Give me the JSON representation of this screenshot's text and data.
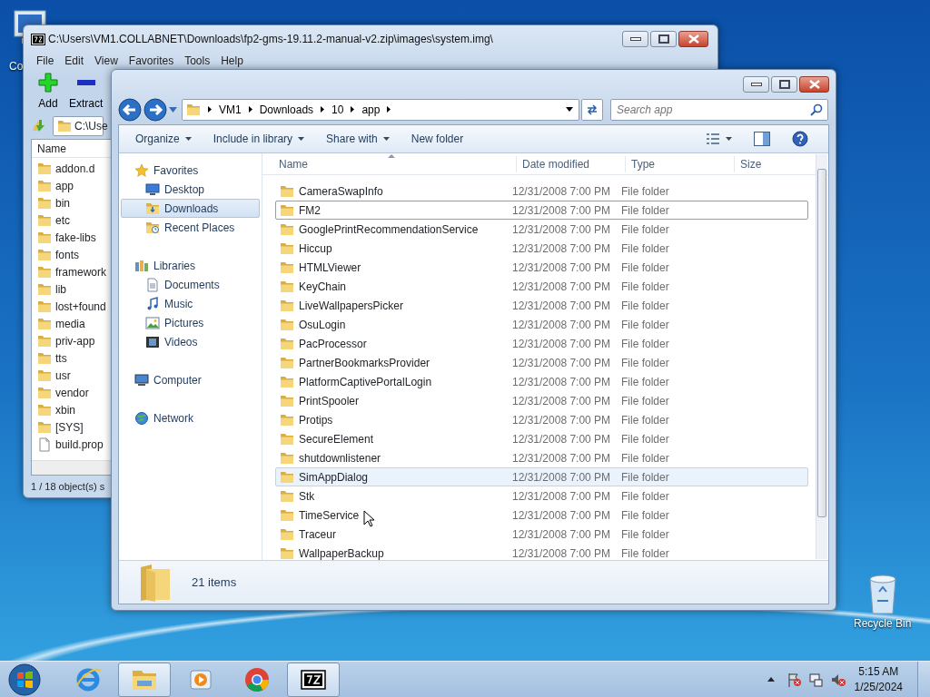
{
  "desktop_icons": [
    {
      "label": "Co",
      "kind": "computer"
    },
    {
      "label": "Recycle Bin",
      "kind": "recycle"
    }
  ],
  "archive_window": {
    "title": "C:\\Users\\VM1.COLLABNET\\Downloads\\fp2-gms-19.11.2-manual-v2.zip\\images\\system.img\\",
    "menu": [
      "File",
      "Edit",
      "View",
      "Favorites",
      "Tools",
      "Help"
    ],
    "toolbar": [
      {
        "label": "Add",
        "kind": "add"
      },
      {
        "label": "Extract",
        "kind": "extract"
      }
    ],
    "address": "C:\\Use",
    "column": "Name",
    "items": [
      {
        "name": "addon.d",
        "kind": "folder"
      },
      {
        "name": "app",
        "kind": "folder"
      },
      {
        "name": "bin",
        "kind": "folder"
      },
      {
        "name": "etc",
        "kind": "folder"
      },
      {
        "name": "fake-libs",
        "kind": "folder"
      },
      {
        "name": "fonts",
        "kind": "folder"
      },
      {
        "name": "framework",
        "kind": "folder"
      },
      {
        "name": "lib",
        "kind": "folder"
      },
      {
        "name": "lost+found",
        "kind": "folder"
      },
      {
        "name": "media",
        "kind": "folder"
      },
      {
        "name": "priv-app",
        "kind": "folder"
      },
      {
        "name": "tts",
        "kind": "folder"
      },
      {
        "name": "usr",
        "kind": "folder"
      },
      {
        "name": "vendor",
        "kind": "folder"
      },
      {
        "name": "xbin",
        "kind": "folder"
      },
      {
        "name": "[SYS]",
        "kind": "folder"
      },
      {
        "name": "build.prop",
        "kind": "file"
      }
    ],
    "status": "1 / 18 object(s) s"
  },
  "explorer": {
    "breadcrumb": [
      "VM1",
      "Downloads",
      "10",
      "app"
    ],
    "search": {
      "placeholder": "Search app"
    },
    "commands": [
      {
        "label": "Organize",
        "dropdown": true
      },
      {
        "label": "Include in library",
        "dropdown": true
      },
      {
        "label": "Share with",
        "dropdown": true
      },
      {
        "label": "New folder",
        "dropdown": false
      }
    ],
    "nav": [
      {
        "label": "Favorites",
        "kind": "favorites",
        "selected": false,
        "children": [
          {
            "label": "Desktop",
            "kind": "desktop",
            "selected": false
          },
          {
            "label": "Downloads",
            "kind": "downloads",
            "selected": true
          },
          {
            "label": "Recent Places",
            "kind": "recent",
            "selected": false
          }
        ]
      },
      {
        "label": "Libraries",
        "kind": "libraries",
        "selected": false,
        "children": [
          {
            "label": "Documents",
            "kind": "documents",
            "selected": false
          },
          {
            "label": "Music",
            "kind": "music",
            "selected": false
          },
          {
            "label": "Pictures",
            "kind": "pictures",
            "selected": false
          },
          {
            "label": "Videos",
            "kind": "videos",
            "selected": false
          }
        ]
      },
      {
        "label": "Computer",
        "kind": "computer",
        "selected": false
      },
      {
        "label": "Network",
        "kind": "network",
        "selected": false
      }
    ],
    "columns": [
      "Name",
      "Date modified",
      "Type",
      "Size"
    ],
    "rows": [
      {
        "name": "CameraSwapInfo",
        "date": "12/31/2008 7:00 PM",
        "type": "File folder",
        "focused": false,
        "hovered": false
      },
      {
        "name": "FM2",
        "date": "12/31/2008 7:00 PM",
        "type": "File folder",
        "focused": true,
        "hovered": false
      },
      {
        "name": "GooglePrintRecommendationService",
        "date": "12/31/2008 7:00 PM",
        "type": "File folder",
        "focused": false,
        "hovered": false
      },
      {
        "name": "Hiccup",
        "date": "12/31/2008 7:00 PM",
        "type": "File folder",
        "focused": false,
        "hovered": false
      },
      {
        "name": "HTMLViewer",
        "date": "12/31/2008 7:00 PM",
        "type": "File folder",
        "focused": false,
        "hovered": false
      },
      {
        "name": "KeyChain",
        "date": "12/31/2008 7:00 PM",
        "type": "File folder",
        "focused": false,
        "hovered": false
      },
      {
        "name": "LiveWallpapersPicker",
        "date": "12/31/2008 7:00 PM",
        "type": "File folder",
        "focused": false,
        "hovered": false
      },
      {
        "name": "OsuLogin",
        "date": "12/31/2008 7:00 PM",
        "type": "File folder",
        "focused": false,
        "hovered": false
      },
      {
        "name": "PacProcessor",
        "date": "12/31/2008 7:00 PM",
        "type": "File folder",
        "focused": false,
        "hovered": false
      },
      {
        "name": "PartnerBookmarksProvider",
        "date": "12/31/2008 7:00 PM",
        "type": "File folder",
        "focused": false,
        "hovered": false
      },
      {
        "name": "PlatformCaptivePortalLogin",
        "date": "12/31/2008 7:00 PM",
        "type": "File folder",
        "focused": false,
        "hovered": false
      },
      {
        "name": "PrintSpooler",
        "date": "12/31/2008 7:00 PM",
        "type": "File folder",
        "focused": false,
        "hovered": false
      },
      {
        "name": "Protips",
        "date": "12/31/2008 7:00 PM",
        "type": "File folder",
        "focused": false,
        "hovered": false
      },
      {
        "name": "SecureElement",
        "date": "12/31/2008 7:00 PM",
        "type": "File folder",
        "focused": false,
        "hovered": false
      },
      {
        "name": "shutdownlistener",
        "date": "12/31/2008 7:00 PM",
        "type": "File folder",
        "focused": false,
        "hovered": false
      },
      {
        "name": "SimAppDialog",
        "date": "12/31/2008 7:00 PM",
        "type": "File folder",
        "focused": false,
        "hovered": true
      },
      {
        "name": "Stk",
        "date": "12/31/2008 7:00 PM",
        "type": "File folder",
        "focused": false,
        "hovered": false
      },
      {
        "name": "TimeService",
        "date": "12/31/2008 7:00 PM",
        "type": "File folder",
        "focused": false,
        "hovered": false
      },
      {
        "name": "Traceur",
        "date": "12/31/2008 7:00 PM",
        "type": "File folder",
        "focused": false,
        "hovered": false
      },
      {
        "name": "WallpaperBackup",
        "date": "12/31/2008 7:00 PM",
        "type": "File folder",
        "focused": false,
        "hovered": false
      }
    ],
    "status": "21 items"
  },
  "taskbar": {
    "apps": [
      {
        "kind": "ie",
        "active": false
      },
      {
        "kind": "explorer",
        "active": true
      },
      {
        "kind": "media",
        "active": false
      },
      {
        "kind": "chrome",
        "active": false
      },
      {
        "kind": "sevenzip",
        "active": true
      }
    ],
    "clock": {
      "time": "5:15 AM",
      "date": "1/25/2024"
    }
  }
}
